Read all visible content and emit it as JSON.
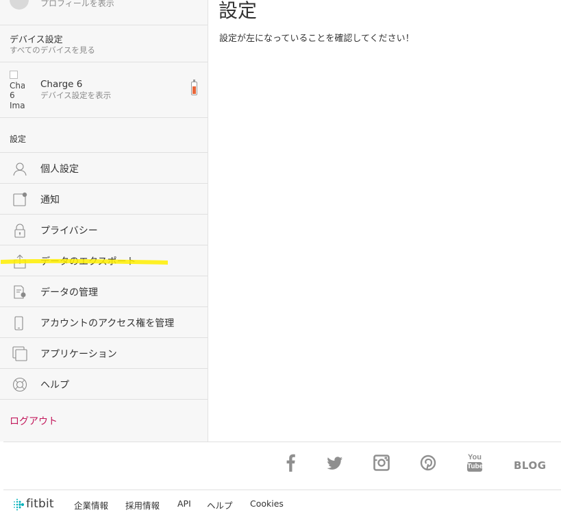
{
  "sidebar": {
    "profile": {
      "subtitle": "プロフィールを表示"
    },
    "device_settings": {
      "title": "デバイス設定",
      "subtitle": "すべてのデバイスを見る"
    },
    "device": {
      "image_alt": "Charge 6 Image",
      "alt_lines": [
        "Cha",
        "6",
        "Ima"
      ],
      "name": "Charge 6",
      "subtitle": "デバイス設定を表示",
      "battery_level": 0.6,
      "battery_color": "#e8673a"
    },
    "settings_header": "設定",
    "menu": [
      {
        "label": "個人設定",
        "icon": "person-icon"
      },
      {
        "label": "通知",
        "icon": "notification-icon"
      },
      {
        "label": "プライバシー",
        "icon": "lock-icon"
      },
      {
        "label": "データのエクスポート",
        "icon": "export-icon"
      },
      {
        "label": "データの管理",
        "icon": "data-manage-icon"
      },
      {
        "label": "アカウントのアクセス権を管理",
        "icon": "phone-icon"
      },
      {
        "label": "アプリケーション",
        "icon": "applications-icon"
      },
      {
        "label": "ヘルプ",
        "icon": "help-icon"
      }
    ],
    "logout": "ログアウト"
  },
  "main": {
    "title": "設定",
    "message": "設定が左になっていることを確認してください！"
  },
  "annotation": {
    "highlight_color": "#ffee00"
  },
  "footer": {
    "social": [
      {
        "name": "facebook-icon"
      },
      {
        "name": "twitter-icon"
      },
      {
        "name": "instagram-icon"
      },
      {
        "name": "pinterest-icon"
      },
      {
        "name": "youtube-icon",
        "text_top": "You",
        "text_bottom": "Tube"
      }
    ],
    "blog": "BLOG",
    "logo": "fitbit",
    "links": [
      "企業情報",
      "採用情報",
      "API",
      "ヘルプ",
      "Cookies"
    ]
  },
  "colors": {
    "accent_logout": "#c2185b",
    "icon_gray": "#8a8a8a",
    "social_gray": "#8f8f8f"
  }
}
